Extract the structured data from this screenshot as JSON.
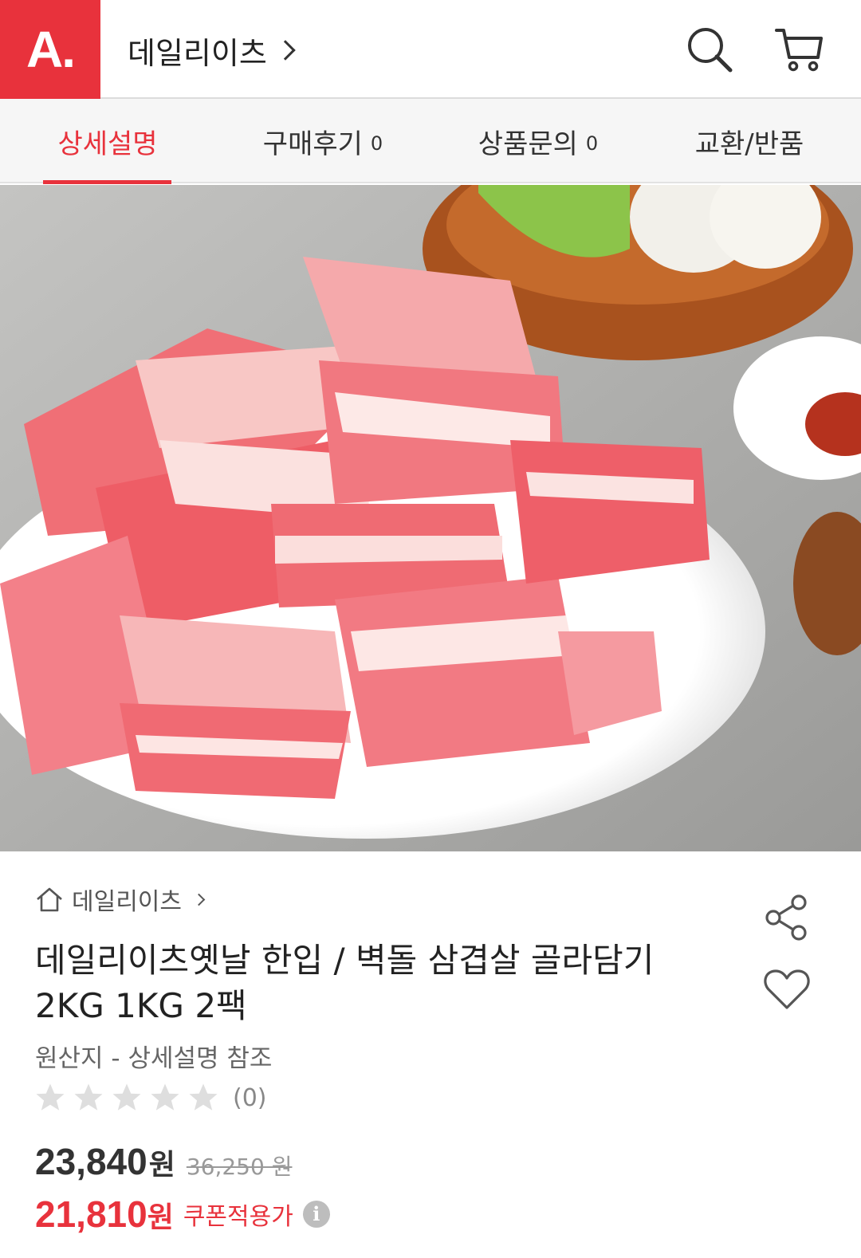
{
  "header": {
    "logo_text": "A.",
    "shop_name": "데일리이츠",
    "icons": [
      "search-icon",
      "cart-icon"
    ]
  },
  "tabs": [
    {
      "label": "상세설명",
      "count": "",
      "active": true
    },
    {
      "label": "구매후기",
      "count": "0",
      "active": false
    },
    {
      "label": "상품문의",
      "count": "0",
      "active": false
    },
    {
      "label": "교환/반품",
      "count": "",
      "active": false
    }
  ],
  "product": {
    "breadcrumb": "데일리이츠",
    "title_line1": "데일리이츠옛날 한입 / 벽돌 삼겹살 골라담기",
    "title_line2": "2KG 1KG 2팩",
    "origin": "원산지 - 상세설명 참조",
    "rating_stars": 0,
    "rating_count": "(0)",
    "price": "23,840",
    "price_unit": "원",
    "original_price": "36,250 원",
    "coupon_price": "21,810",
    "coupon_unit": "원",
    "coupon_label": "쿠폰적용가",
    "info_glyph": "i"
  },
  "colors": {
    "accent": "#e8323c",
    "text": "#222222",
    "muted": "#888888"
  }
}
